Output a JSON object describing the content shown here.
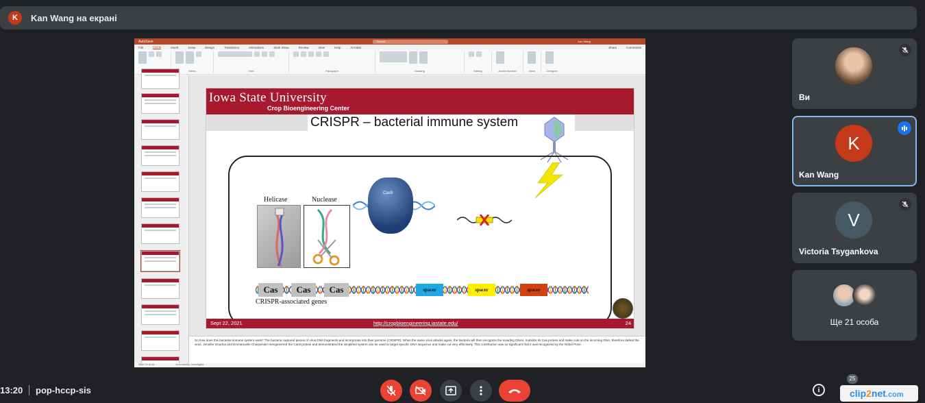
{
  "topbar": {
    "avatar_letter": "K",
    "title": "Kan Wang на екрані"
  },
  "ppt": {
    "autosave": "AutoSave",
    "search_placeholder": "Search",
    "user": "Kan Wang",
    "share": "Share",
    "comments": "Comments",
    "tabs": [
      "File",
      "Home",
      "Insert",
      "Draw",
      "Design",
      "Transitions",
      "Animations",
      "Slide Show",
      "Review",
      "View",
      "Help",
      "Acrobat"
    ],
    "active_tab": "Home",
    "ribbon_groups": [
      "Clipboard",
      "Slides",
      "Font",
      "Paragraph",
      "Drawing",
      "Editing",
      "Adobe Acrobat",
      "Voice",
      "Designer"
    ]
  },
  "slide": {
    "university": "Iowa State University",
    "center": "Crop Bioengineering Center",
    "title": "CRISPR – bacterial immune system",
    "helicase_label": "Helicase",
    "nuclease_label": "Nuclease",
    "cas9_label": "Cas9",
    "cas_boxes": [
      "Cas",
      "Cas",
      "Cas"
    ],
    "spacers": [
      {
        "label": "spacer",
        "color": "#1ca9e6"
      },
      {
        "label": "spacer",
        "color": "#ffee00"
      },
      {
        "label": "spacer",
        "color": "#d4410f"
      }
    ],
    "genes_label": "CRISPR-associated genes",
    "footer_date": "Sept 22, 2021",
    "footer_url": "http://cropbioengineering.iastate.edu/",
    "page_number": "24",
    "brand_color": "#a6192e"
  },
  "notes": {
    "text": "So how does this bacterial immune system work? The bacteria captured pieces of virus DNA fragments and incorporate into their genome (CRISPR). When the same virus attacks again, the bacteria will then recognize the invading DNAs, mobilize its Cas protein and make cuts on the incoming DNA, therefore defeat the virus. Jennifer Doudna and Emmanuelle Charpentier reengineered the Cas9 protein and demonstrated the simplified system can be used to target specific DNA sequence and make cut very effectively. This contribution was so significant that it was recognized by the Nobel Prize."
  },
  "status": {
    "slide_info": "Slide 24 of 46",
    "accessibility": "Accessibility: Investigate"
  },
  "participants": [
    {
      "name": "Ви",
      "type": "photo",
      "muted": true
    },
    {
      "name": "Kan Wang",
      "initial": "K",
      "avatar_color": "#c5391b",
      "speaking": true
    },
    {
      "name": "Victoria Tsygankova",
      "initial": "V",
      "avatar_color": "#455a64",
      "muted": true
    },
    {
      "name": "Ще 21 особа",
      "type": "group"
    }
  ],
  "bottom": {
    "time": "13:20",
    "meeting_code": "pop-hccp-sis",
    "participants_count": "25",
    "info_glyph": "i"
  },
  "watermark": {
    "text_a": "clip",
    "text_b": "2",
    "text_c": "net",
    "text_d": ".com"
  }
}
